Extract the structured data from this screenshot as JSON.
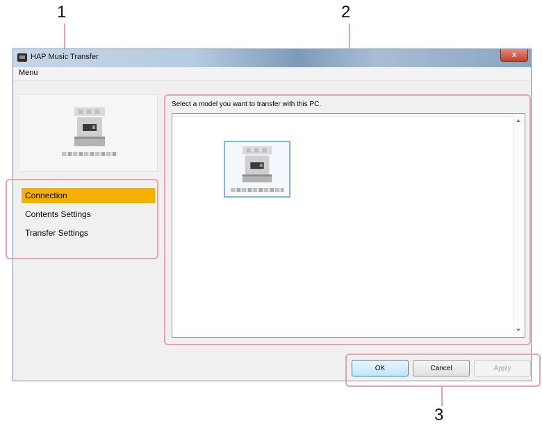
{
  "callouts": [
    "1",
    "2",
    "3"
  ],
  "window": {
    "title": "HAP Music Transfer",
    "close_glyph": "x",
    "menu": [
      "Menu"
    ]
  },
  "nav": {
    "items": [
      {
        "label": "Connection",
        "active": true
      },
      {
        "label": "Contents Settings",
        "active": false
      },
      {
        "label": "Transfer Settings",
        "active": false
      }
    ]
  },
  "main": {
    "caption": "Select a model you want to transfer with this PC."
  },
  "buttons": {
    "ok": "OK",
    "cancel": "Cancel",
    "apply": "Apply"
  },
  "colors": {
    "highlight": "#f6b100",
    "callout": "#e8a0b3",
    "selection_border": "#7fb4ea"
  },
  "icons": [
    "app-icon",
    "device-icon",
    "scroll-up-arrow-icon",
    "scroll-down-arrow-icon"
  ]
}
